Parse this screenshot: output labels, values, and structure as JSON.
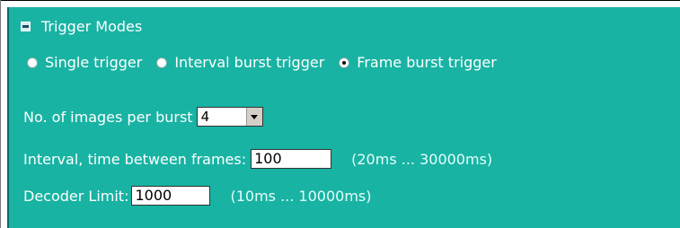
{
  "section": {
    "title": "Trigger Modes",
    "collapse_icon": "minus-square-icon"
  },
  "trigger_modes": [
    {
      "label": "Single trigger",
      "selected": false
    },
    {
      "label": "Interval burst trigger",
      "selected": false
    },
    {
      "label": "Frame burst trigger",
      "selected": true
    }
  ],
  "images_per_burst": {
    "label": "No. of images per burst",
    "value": "4"
  },
  "interval": {
    "label": "Interval, time between frames:",
    "value": "100",
    "range": "(20ms ... 30000ms)"
  },
  "decoder_limit": {
    "label": "Decoder Limit:",
    "value": "1000",
    "range": "(10ms ... 10000ms)"
  },
  "colors": {
    "panel_bg": "#18b3a3",
    "text": "#ffffff"
  }
}
